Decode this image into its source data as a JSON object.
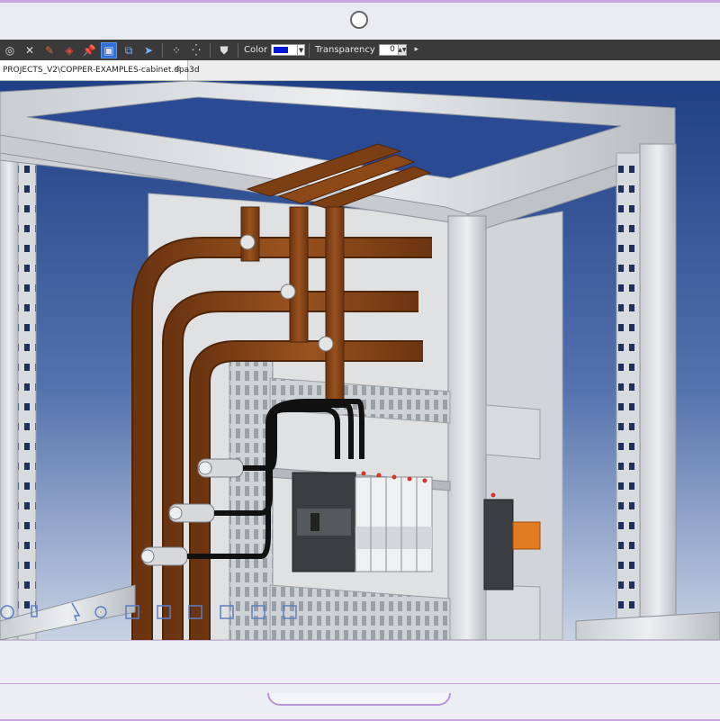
{
  "toolbar": {
    "color_label": "Color",
    "transparency_label": "Transparency",
    "transparency_value": "0",
    "current_color": "#0018d6",
    "icons": [
      "target-icon",
      "delete-x-icon",
      "pencil-icon",
      "snap-diamond-icon",
      "pin-icon",
      "select-box-icon",
      "copy-window-icon",
      "arrow-cursor-icon",
      "dots-icon",
      "grid-icon",
      "shield-icon"
    ]
  },
  "tab": {
    "label": "PROJECTS_V2\\COPPER-EXAMPLES-cabinet.dpa3d",
    "close": "⊗"
  },
  "view_controls": {
    "icons": [
      "rotate-icon",
      "pan-hand-icon",
      "cursor-icon",
      "zoom-icon",
      "cube-front-icon",
      "cube-top-icon",
      "cube-left-icon",
      "cube-right-icon",
      "cube-back-icon",
      "cube-iso-icon"
    ]
  },
  "colors": {
    "background_top": "#1f3f86",
    "background_bottom": "#b8c6de",
    "frame": "#d6d9dc",
    "copper": "#8a4718",
    "accent_orange": "#e27c22"
  }
}
